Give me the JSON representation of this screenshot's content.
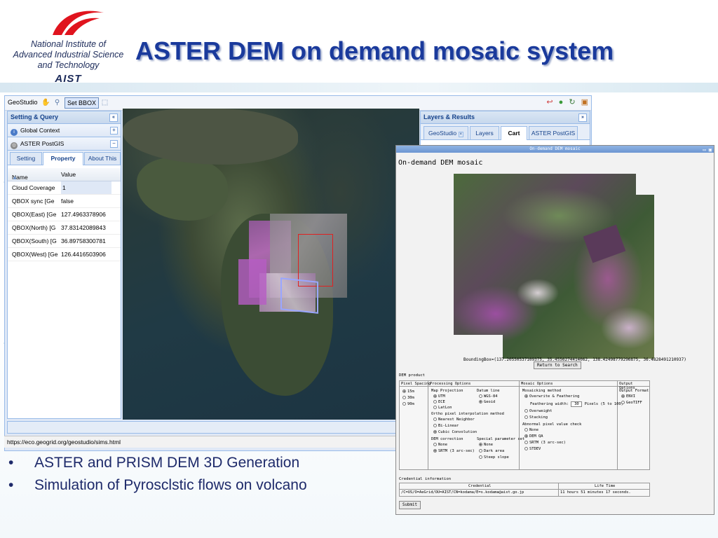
{
  "slide": {
    "logo_text": [
      "National Institute of",
      "Advanced Industrial Science",
      "and Technology"
    ],
    "logo_abbr": "AIST",
    "title": "ASTER DEM on demand mosaic system"
  },
  "geostudio": {
    "brand": "GeoStudio",
    "set_bbox_button": "Set BBOX",
    "left_panel": {
      "title": "Setting & Query",
      "accordion": [
        "Global Context",
        "ASTER PostGIS"
      ],
      "tabs": [
        "Setting",
        "Property",
        "About This"
      ],
      "columns": [
        "Name",
        "Value"
      ],
      "rows": [
        {
          "name": "Cloud Coverage",
          "value": "1"
        },
        {
          "name": "QBOX sync [Ge",
          "value": "false"
        },
        {
          "name": "QBOX(East) [Ge",
          "value": "127.4963378906"
        },
        {
          "name": "QBOX(North) [G",
          "value": "37.83142089843"
        },
        {
          "name": "QBOX(South) [G",
          "value": "36.89758300781"
        },
        {
          "name": "QBOX(West) [Ge",
          "value": "126.4416503906"
        }
      ]
    },
    "right_panel": {
      "title": "Layers & Results",
      "tabs": [
        "GeoStudio",
        "Layers",
        "Cart",
        "ASTER PostGIS"
      ]
    },
    "status_url": "https://eco.geogrid.org/geostudio/sims.html"
  },
  "ondemand": {
    "window_title": "On-demand DEM mosaic",
    "heading": "On-demand DEM mosaic",
    "bounding_box": "BoundingBox=(137.20550537109375, 35.4556274414062, 138.42498779296875, 36.4828491210937)",
    "return_button": "Return to Search",
    "dem_product": "DEM product",
    "col_headers": [
      "Pixel Spacing",
      "Processing Options",
      "Mosaic Options",
      "Output Options"
    ],
    "pixel_spacing": [
      "15m",
      "30m",
      "90m"
    ],
    "map_projection_label": "Map Projection",
    "map_projection": [
      "UTM",
      "ECE",
      "LatLon"
    ],
    "datum_label": "Datum line",
    "datum": [
      "WGS-84",
      "Geoid"
    ],
    "ortho_label": "Ortho pixel interpolation method",
    "ortho": [
      "Nearest Neighbor",
      "Bi-Linear",
      "Cubic Convolution"
    ],
    "dem_correction_label": "DEM correction",
    "dem_correction": [
      "None",
      "SRTM (3 arc-sec)"
    ],
    "special_label": "Special parameter set",
    "special": [
      "None",
      "Dark area",
      "Steep slope"
    ],
    "mosaic_method_label": "Mosaicking method",
    "mosaic_method": [
      "Overwrite & Feathering",
      "Overweight",
      "Stacking"
    ],
    "feathering_label": "Feathering width:",
    "feathering_value": "30",
    "feathering_unit": "Pixels (5 to 100)",
    "abnormal_label": "Abnormal pixel value check",
    "abnormal": [
      "None",
      "DEM QA",
      "SRTM (3 arc-sec)",
      "STDEV"
    ],
    "output_format_label": "Output Format",
    "output_format": [
      "ENVI",
      "GeoTIFF"
    ],
    "credential_title": "Credential information",
    "credential_head": "Credential",
    "lifetime_head": "Life Time",
    "credential_value": "/C=US/O=AeGrid/OU=AIST/CN=kodama/E=s.kodama@aist.go.jp",
    "lifetime_value": "11 hours 51 minutes 17 seconds.",
    "submit": "Submit"
  },
  "bullets": [
    "ASTER and PRISM DEM 3D Generation",
    "Simulation of Pyrosclstic flows on volcano"
  ],
  "colors": {
    "title": "#1a3a9c",
    "panel_header": "#15428b",
    "bullet_text": "#1e2a6a",
    "bbox_red": "#e02020"
  }
}
